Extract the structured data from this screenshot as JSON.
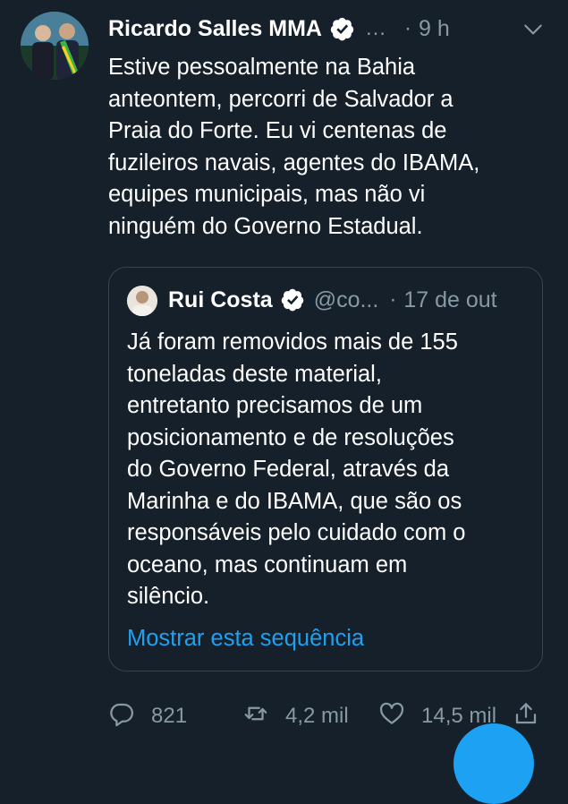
{
  "tweet": {
    "author_name": "Ricardo Salles MMA",
    "handle_truncated": "...",
    "separator": "·",
    "time": "9 h",
    "text_lines": [
      "Estive  pessoalmente na Bahia",
      "anteontem, percorri de Salvador a",
      "Praia do Forte. Eu vi centenas de",
      "fuzileiros navais, agentes do IBAMA,",
      "equipes municipais, mas não vi",
      "ninguém do Governo Estadual."
    ]
  },
  "quoted": {
    "author_name": "Rui Costa",
    "handle": "@co...",
    "separator": "·",
    "date": "17 de out",
    "text_lines": [
      "Já foram removidos mais de 155",
      "toneladas deste material,",
      "entretanto precisamos de um",
      "posicionamento e de resoluções",
      "do Governo Federal, através da",
      "Marinha e do IBAMA, que são os",
      "responsáveis pelo cuidado com o",
      "oceano, mas continuam em",
      "silêncio."
    ],
    "show_thread_label": "Mostrar esta sequência"
  },
  "actions": {
    "replies": "821",
    "retweets": "4,2 mil",
    "likes": "14,5 mil"
  },
  "colors": {
    "background": "#15202b",
    "secondary_text": "#8899a6",
    "accent": "#1da1f2",
    "border": "#38444d"
  },
  "icons": [
    "verified-badge-icon",
    "chevron-down-icon",
    "reply-icon",
    "retweet-icon",
    "like-icon",
    "share-icon"
  ]
}
